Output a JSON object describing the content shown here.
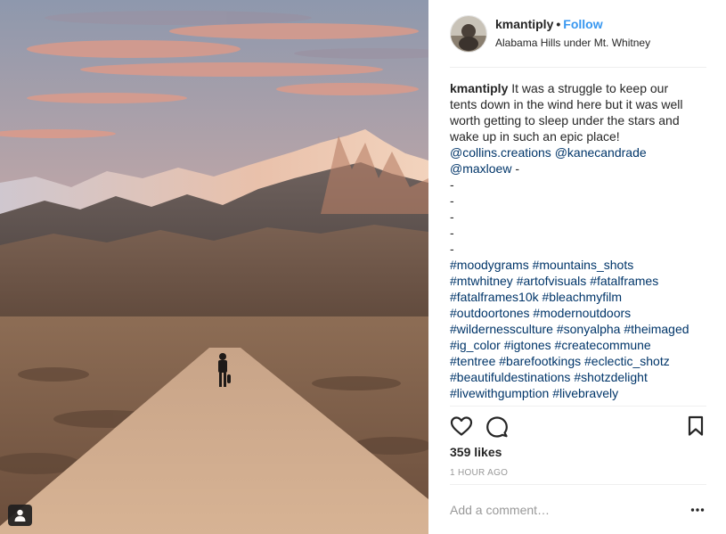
{
  "post": {
    "username": "kmantiply",
    "separator": "•",
    "follow_label": "Follow",
    "location": "Alabama Hills under Mt. Whitney",
    "caption": {
      "username": "kmantiply",
      "line1": "It was a struggle to keep our",
      "line2": "tents down in the wind here but it was well",
      "line3": "worth getting to sleep under the stars and",
      "line4": "wake up in such an epic place!",
      "mention1": "@collins.creations",
      "mention2": "@kanecandrade",
      "mention3": "@maxloew",
      "after_mention3": " -",
      "dash": "-",
      "tags": [
        [
          "#moodygrams",
          "#mountains_shots"
        ],
        [
          "#mtwhitney",
          "#artofvisuals",
          "#fatalframes"
        ],
        [
          "#fatalframes10k",
          "#bleachmyfilm"
        ],
        [
          "#outdoortones",
          "#modernoutdoors"
        ],
        [
          "#wildernessculture",
          "#sonyalpha",
          "#theimaged"
        ],
        [
          "#ig_color",
          "#igtones",
          "#createcommune"
        ],
        [
          "#tentree",
          "#barefootkings",
          "#eclectic_shotz"
        ],
        [
          "#beautifuldestinations",
          "#shotzdelight"
        ],
        [
          "#livewithgumption",
          "#livebravely"
        ]
      ]
    },
    "likes": "359 likes",
    "timestamp": "1 HOUR AGO",
    "comment_placeholder": "Add a comment…"
  },
  "icons": {
    "like": "heart-outline-icon",
    "comment": "speech-bubble-icon",
    "save": "bookmark-icon",
    "more": "ellipsis-icon",
    "tagged": "person-tag-icon"
  },
  "colors": {
    "link": "#003569",
    "follow": "#3897f0",
    "text": "#262626",
    "muted": "#999999",
    "divider": "#efefef"
  }
}
